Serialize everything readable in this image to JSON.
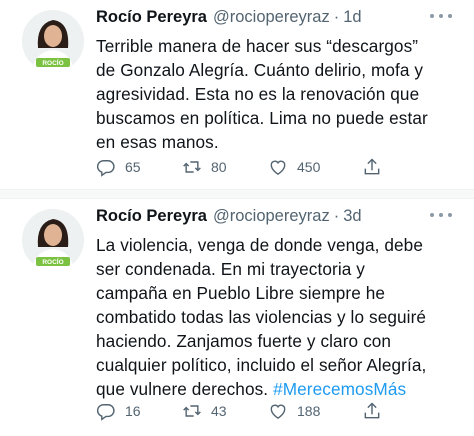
{
  "tweets": [
    {
      "author_name": "Rocío Pereyra",
      "handle": "@rociopereyraz",
      "separator": "·",
      "time": "1d",
      "avatar_caption": "ROCÍO",
      "text": "Terrible manera de hacer sus “descargos”\nde Gonzalo Alegría. Cuánto delirio, mofa y\nagresividad. Esta no es la renovación que\nbuscamos en política. Lima no puede estar\nen esas manos.",
      "hashtag": "",
      "replies": "65",
      "retweets": "80",
      "likes": "450"
    },
    {
      "author_name": "Rocío Pereyra",
      "handle": "@rociopereyraz",
      "separator": "·",
      "time": "3d",
      "avatar_caption": "ROCÍO",
      "text": "La violencia, venga de donde venga, debe\nser condenada. En mi trayectoria y\ncampaña en Pueblo Libre siempre he\ncombatido todas las violencias y lo seguiré\nhaciendo. Zanjamos fuerte y claro con\ncualquier político, incluido el señor Alegría,\nque vulnere derechos. ",
      "hashtag": "#MerecemosMás",
      "replies": "16",
      "retweets": "43",
      "likes": "188"
    }
  ],
  "icons": {
    "reply": "reply-icon",
    "retweet": "retweet-icon",
    "like": "heart-icon",
    "share": "share-icon",
    "more": "more-options-icon"
  },
  "colors": {
    "text": "#0f1419",
    "secondary": "#536471",
    "hashtag": "#1d9bf0",
    "avatar_green": "#7cc242"
  }
}
